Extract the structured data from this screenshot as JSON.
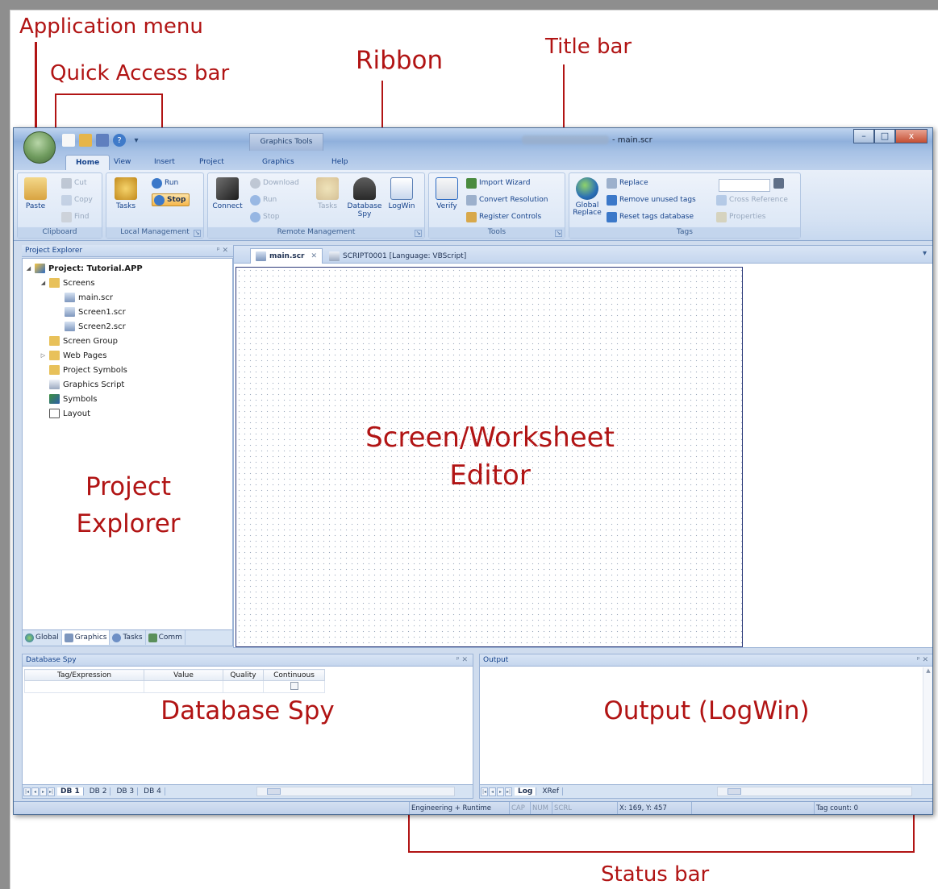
{
  "annotations": {
    "application_menu": "Application menu",
    "quick_access_bar": "Quick Access bar",
    "ribbon": "Ribbon",
    "title_bar": "Title bar",
    "status_bar": "Status bar"
  },
  "title_bar": {
    "contextual_tab": "Graphics Tools",
    "document": "- main.scr",
    "buttons": {
      "minimize": "–",
      "maximize": "□",
      "close": "x"
    }
  },
  "quick_access": {
    "items": [
      "new-file-icon",
      "open-folder-icon",
      "save-icon",
      "help-icon",
      "customize-dropdown-icon"
    ],
    "dropdown": "▾"
  },
  "ribbon_tabs": [
    "Home",
    "View",
    "Insert",
    "Project",
    "Graphics",
    "Help"
  ],
  "ribbon": {
    "clipboard": {
      "label": "Clipboard",
      "paste": "Paste",
      "cut": "Cut",
      "copy": "Copy",
      "find": "Find"
    },
    "local_management": {
      "label": "Local Management",
      "tasks": "Tasks",
      "run": "Run",
      "stop": "Stop"
    },
    "remote_management": {
      "label": "Remote Management",
      "connect": "Connect",
      "download": "Download",
      "run": "Run",
      "stop": "Stop",
      "tasks": "Tasks",
      "database_spy": "Database Spy",
      "logwin": "LogWin"
    },
    "tools": {
      "label": "Tools",
      "verify": "Verify",
      "import_wizard": "Import Wizard",
      "convert_resolution": "Convert Resolution",
      "register_controls": "Register Controls"
    },
    "tags": {
      "label": "Tags",
      "global_replace": "Global Replace",
      "replace": "Replace",
      "remove_unused_tags": "Remove unused tags",
      "reset_tags_database": "Reset tags database",
      "cross_reference": "Cross Reference",
      "properties": "Properties"
    }
  },
  "project_explorer": {
    "header": "Project Explorer",
    "controls": "ᵖ ✕",
    "tree": [
      {
        "label": "Project: Tutorial.APP",
        "bold": true
      },
      {
        "label": "Screens"
      },
      {
        "label": "main.scr"
      },
      {
        "label": "Screen1.scr"
      },
      {
        "label": "Screen2.scr"
      },
      {
        "label": "Screen Group"
      },
      {
        "label": "Web Pages"
      },
      {
        "label": "Project Symbols"
      },
      {
        "label": "Graphics Script"
      },
      {
        "label": "Symbols"
      },
      {
        "label": "Layout"
      }
    ],
    "overlay_label_1": "Project",
    "overlay_label_2": "Explorer",
    "tabs": [
      "Global",
      "Graphics",
      "Tasks",
      "Comm"
    ]
  },
  "editor": {
    "tabs": [
      "main.scr",
      "SCRIPT0001 [Language: VBScript]"
    ],
    "tab_close": "✕",
    "menu_arrow": "▾",
    "overlay_label_1": "Screen/Worksheet",
    "overlay_label_2": "Editor"
  },
  "database_spy": {
    "header": "Database Spy",
    "controls": "ᵖ ✕",
    "columns": [
      "Tag/Expression",
      "Value",
      "Quality",
      "Continuous"
    ],
    "overlay_label": "Database Spy",
    "sheets": [
      "DB 1",
      "DB 2",
      "DB 3",
      "DB 4"
    ]
  },
  "output": {
    "header": "Output",
    "controls": "ᵖ ✕",
    "overlay_label": "Output (LogWin)",
    "sheets": [
      "Log",
      "XRef"
    ]
  },
  "status": {
    "mode": "Engineering + Runtime",
    "cap": "CAP",
    "num": "NUM",
    "scrl": "SCRL",
    "coords": "X: 169, Y: 457",
    "tag_count": "Tag count: 0"
  },
  "colors": {
    "annotation": "#b11414",
    "window_frame": "#4b6d97",
    "ribbon_text": "#15428b"
  }
}
